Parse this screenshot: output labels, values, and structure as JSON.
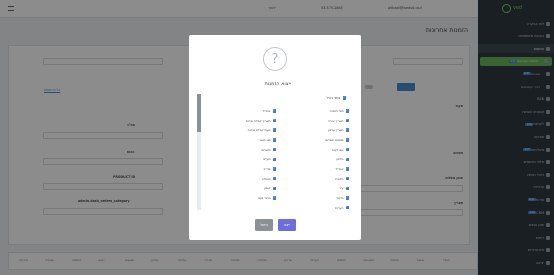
{
  "topbar": {
    "email": "pitkaot@wedsit.co.il",
    "phone": "03-575-2865",
    "user": "ליאור"
  },
  "sidebar": {
    "logo_text": "ved",
    "items": [
      {
        "label": "לוח הבקרה"
      },
      {
        "label": "בקשות משתמשים"
      },
      {
        "label": "הזמנות",
        "active": true
      },
      {
        "label": "הזמנות אחרונות",
        "badge": "חדש",
        "highlight": true
      },
      {
        "label": "מוצרים",
        "badge": "חדש"
      },
      {
        "label": "דיוור וקמפיינים"
      },
      {
        "label": "B2B"
      },
      {
        "label": "קופונים והנחות"
      },
      {
        "label": "לקוחות",
        "badge": "חדש"
      },
      {
        "label": "ספקים"
      },
      {
        "label": "משלוחים",
        "badge": "חדש"
      },
      {
        "label": "מלאי ומחסנים"
      },
      {
        "label": "ניהול חנויות"
      },
      {
        "label": "הגדרות"
      },
      {
        "label": "אודות",
        "badge": "חדש"
      },
      {
        "label": "CRM",
        "badge": "חדש"
      },
      {
        "label": "תוכן ועיצוב"
      },
      {
        "label": "דוחות"
      },
      {
        "label": "אינטגרציות"
      },
      {
        "label": "יציאה"
      }
    ]
  },
  "page": {
    "title": "הזמנות אחרונות",
    "link": "כל ההזמנות",
    "labels": {
      "status": "סטטוס",
      "search": "חיפוש",
      "source": "מקור",
      "quantity": "כמות",
      "product": "PRODUCT ID",
      "category": "admin.dash_orders_category",
      "shipping": "אופן משלוח",
      "total": "סה\"כ",
      "date": "תאריך"
    }
  },
  "bottombar": {
    "items": [
      "מחיקה",
      "שכפול",
      "הדפסה",
      "ייצוא",
      "סטטוס",
      "עדכון",
      "שליחה",
      "סגירה",
      "פתיחה",
      "הסתרה",
      "ארכיון",
      "הערות",
      "תשלום",
      "חשבונית",
      "משלוח",
      "אישור",
      "ביטול"
    ]
  },
  "modal": {
    "title": "ייצוא הזמנות",
    "select_all": "בחר הכל",
    "col1": [
      "מס' הזמנה",
      "תאריך יצירה",
      "תאריך עדכון",
      "סטטוס תשלום",
      "שם לקוח",
      "טלפון",
      "אימייל",
      "כתובת",
      "עיר",
      "מיקוד",
      "הערות"
    ],
    "col2": [
      "אימייל",
      "תאריך קבלת שירות",
      "שעת קבלת שירות",
      "סוג מוצר",
      "מוצרים",
      "מע\"מ",
      "סה\"כ",
      "משלוח",
      "קופון",
      "מחיר סופי"
    ],
    "yes_label": "ייצא",
    "cancel_label": "ביטול"
  }
}
